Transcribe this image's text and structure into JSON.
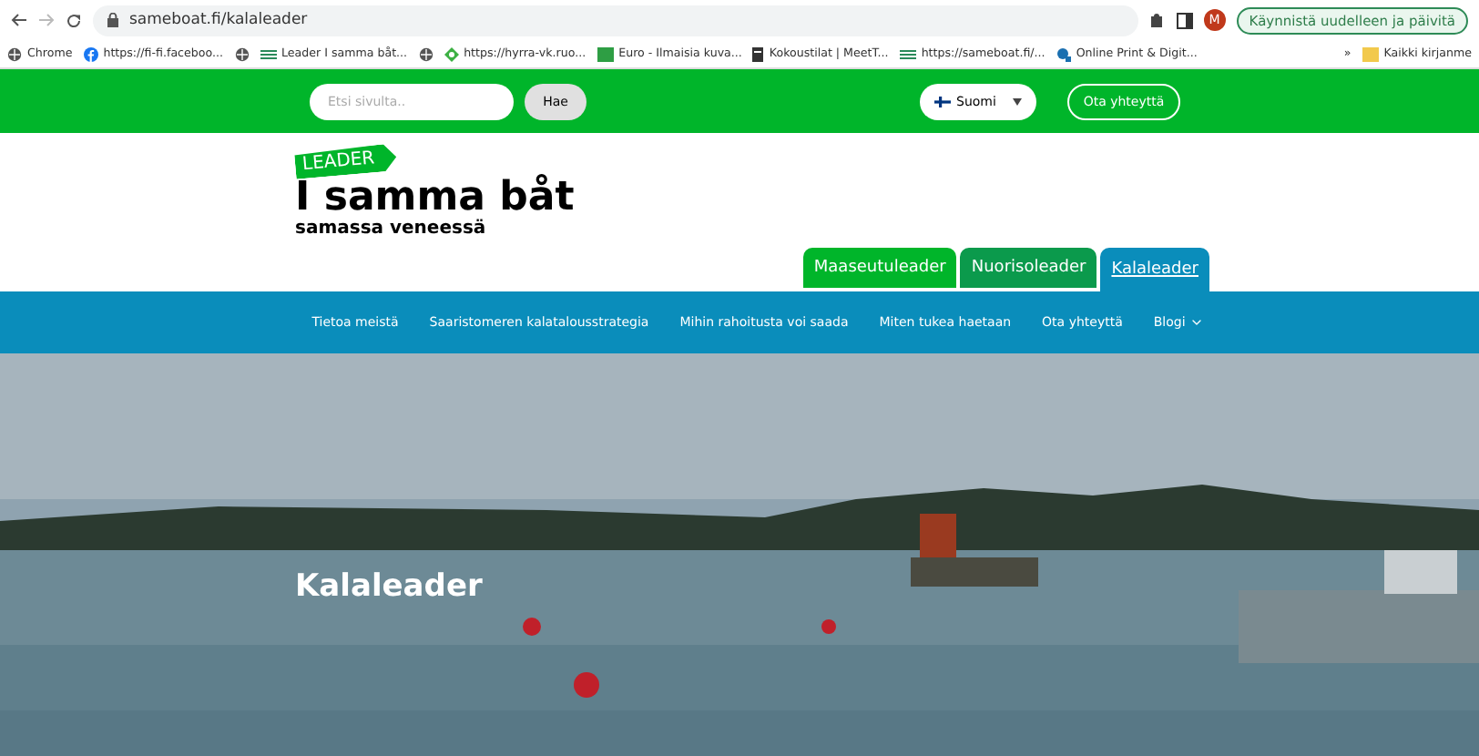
{
  "browser": {
    "url": "sameboat.fi/kalaleader",
    "update_button": "Käynnistä uudelleen ja päivitä",
    "profile_initial": "M",
    "bookmarks": [
      {
        "label": "Chrome",
        "kind": "globe"
      },
      {
        "label": "https://fi-fi.faceboo...",
        "kind": "facebook"
      },
      {
        "kind": "globe"
      },
      {
        "label": "Leader I samma båt...",
        "kind": "leader"
      },
      {
        "kind": "globe"
      },
      {
        "label": "https://hyrra-vk.ruo...",
        "kind": "leaf"
      },
      {
        "label": "Euro - Ilmaisia kuva...",
        "kind": "px"
      },
      {
        "label": "Kokoustilat | MeetT...",
        "kind": "doc"
      },
      {
        "label": "https://sameboat.fi/...",
        "kind": "leader"
      },
      {
        "label": "Online Print & Digit...",
        "kind": "print"
      }
    ],
    "more": "»",
    "all_bookmarks": "Kaikki kirjanme"
  },
  "topbar": {
    "search_placeholder": "Etsi sivulta..",
    "search_button": "Hae",
    "language": "Suomi",
    "contact_button": "Ota yhteyttä"
  },
  "logo": {
    "badge": "LEADER",
    "title": "I samma båt",
    "subtitle": "samassa veneessä"
  },
  "tabs": [
    {
      "label": "Maaseutuleader",
      "selected": false,
      "color": "#00b52a"
    },
    {
      "label": "Nuorisoleader",
      "selected": false,
      "color": "#0b9a4c"
    },
    {
      "label": "Kalaleader",
      "selected": true,
      "color": "#0a8dbb"
    }
  ],
  "nav": [
    {
      "label": "Tietoa meistä",
      "dropdown": false
    },
    {
      "label": "Saaristomeren kalatalousstrategia",
      "dropdown": false
    },
    {
      "label": "Mihin rahoitusta voi saada",
      "dropdown": false
    },
    {
      "label": "Miten tukea haetaan",
      "dropdown": false
    },
    {
      "label": "Ota yhteyttä",
      "dropdown": false
    },
    {
      "label": "Blogi",
      "dropdown": true
    }
  ],
  "hero": {
    "kind": "picture",
    "title": "Kalaleader"
  }
}
